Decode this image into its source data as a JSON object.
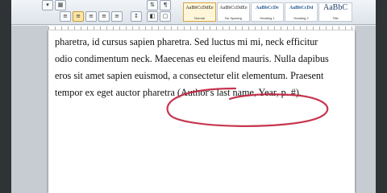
{
  "ribbon": {
    "styles": [
      {
        "preview": "AaBbCcDdEe",
        "name": "Normal",
        "active": true
      },
      {
        "preview": "AaBbCcDdEe",
        "name": "No Spacing",
        "active": false
      },
      {
        "preview": "AaBbCcDe",
        "name": "Heading 1",
        "active": false
      },
      {
        "preview": "AaBbCcDd",
        "name": "Heading 2",
        "active": false
      },
      {
        "preview": "AaBbC",
        "name": "Title",
        "active": false
      }
    ]
  },
  "document": {
    "lines": [
      "pharetra, id cursus sapien pharetra. Sed luctus mi mi, neck efficitur",
      "odio condimentum neck. Maecenas eu eleifend mauris. Nulla dapibus",
      "eros sit amet sapien euismod, a consectetur elit elementum. Praesent",
      "tempor ex eget auctor pharetra (Author's last name, Year, p. #)."
    ]
  },
  "annotation": {
    "color": "#c0203c"
  }
}
